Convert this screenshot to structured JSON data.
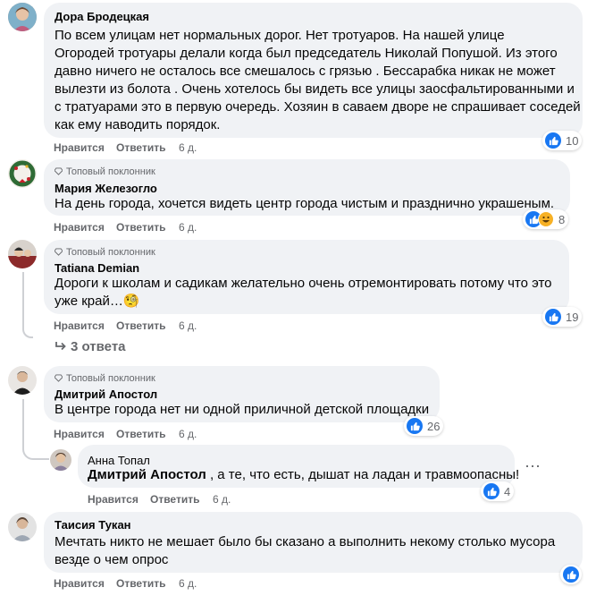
{
  "actions": {
    "like": "Нравится",
    "reply": "Ответить"
  },
  "badge": "Топовый поклонник",
  "comments": [
    {
      "author": "Дора Бродецкая",
      "lines": [
        "По всем улицам нет нормальных дорог. Нет тротуаров. На нашей улице",
        "Огородей тротуары делали когда был председатель Николай Попушой. Из этого",
        "давно ничего не осталось все смешалось с грязью . Бессарабка никак не может",
        "вылезти из болота . Очень хотелось бы видеть все улицы заосфальтированными и",
        "с тратуарами это в первую очередь. Хозяин в саваем дворе не спрашивает соседей",
        "как ему наводить порядок."
      ],
      "time": "6 д.",
      "reactions": "10"
    },
    {
      "author": "Мария Железогло",
      "lines": [
        "На день города, хочется видеть центр города чистым и празднично украшеным."
      ],
      "time": "6 д.",
      "reactions": "8"
    },
    {
      "author": "Tatiana Demian",
      "lines": [
        "Дороги к школам и садикам желательно очень отремонтировать потому что это",
        "уже край…🧐"
      ],
      "time": "6 д.",
      "reactions": "19",
      "replies": "3 ответа"
    },
    {
      "author": "Дмитрий Апостол",
      "lines": [
        "В центре города нет ни одной приличной детской площадки"
      ],
      "time": "6 д.",
      "reactions": "26"
    },
    {
      "author": "Таисия Тукан",
      "lines": [
        "Мечтать никто не мешает было бы сказано а выполнить некому столько мусора",
        "везде о чем опрос"
      ],
      "time": "6 д.",
      "reactions": ""
    }
  ],
  "reply": {
    "author": "Анна Топал",
    "mention": "Дмитрий Апостол",
    "text": " , а те, что есть, дышат на ладан и травмоопасны!",
    "time": "6 д.",
    "reactions": "4",
    "more": "⋯"
  },
  "colors": {
    "like_blue": "#1877f2",
    "bubble": "#f0f2f5",
    "meta": "#65676b"
  }
}
